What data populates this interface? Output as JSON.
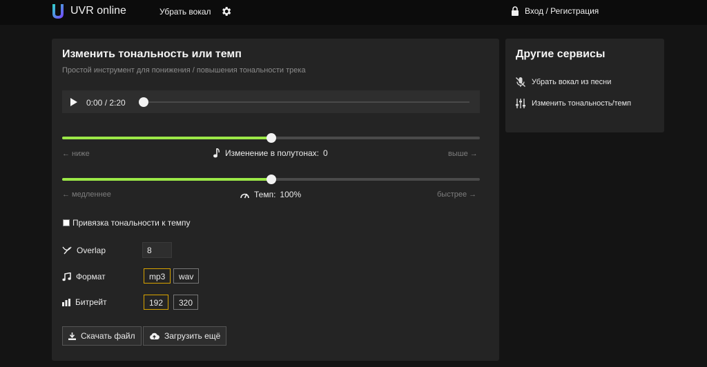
{
  "header": {
    "brand": "UVR online",
    "nav_remove_vocal": "Убрать вокал",
    "settings_icon": "gear-icon",
    "login": "Вход / Регистрация"
  },
  "main": {
    "title": "Изменить тональность или темп",
    "subtitle": "Простой инструмент для понижения / повышения тональности трека",
    "player": {
      "time": "0:00 / 2:20",
      "progress": 0.0
    },
    "pitch": {
      "left_hint": "← ниже",
      "right_hint": "выше →",
      "label": "Изменение в полутонах:",
      "value": "0",
      "position": 0.5
    },
    "tempo": {
      "left_hint": "← медленнее",
      "right_hint": "быстрее →",
      "label": "Темп:",
      "value": "100%",
      "position": 0.5
    },
    "link_checkbox": {
      "label": "Привязка тональности к темпу",
      "checked": false
    },
    "overlap": {
      "label": "Overlap",
      "value": "8"
    },
    "format": {
      "label": "Формат",
      "options": [
        "mp3",
        "wav"
      ],
      "selected": "mp3"
    },
    "bitrate": {
      "label": "Битрейт",
      "options": [
        "192",
        "320"
      ],
      "selected": "192"
    },
    "download_button": "Скачать файл",
    "upload_button": "Загрузить ещё"
  },
  "side": {
    "title": "Другие сервисы",
    "items": [
      {
        "label": "Убрать вокал из песни",
        "icon": "mic-off-icon"
      },
      {
        "label": "Изменить тональность/темп",
        "icon": "sliders-icon"
      }
    ]
  },
  "colors": {
    "accent": "#9be847",
    "selected_border": "#d9a400",
    "brand_gradient": [
      "#2fd6c9",
      "#7a3cff"
    ]
  }
}
